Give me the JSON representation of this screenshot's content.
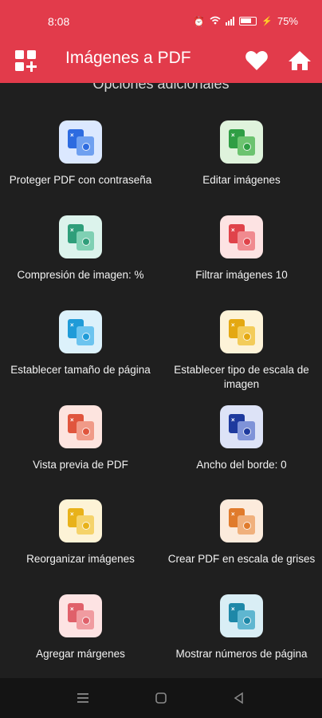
{
  "status": {
    "time": "8:08",
    "battery": "75%"
  },
  "app_bar": {
    "title": "Imágenes a PDF",
    "icons": [
      "apps-add-icon",
      "heart-icon",
      "home-icon"
    ]
  },
  "section_title": "Opciones adicionales",
  "options": [
    {
      "label": "Proteger PDF con contraseña",
      "icon": "lock-shield-icon",
      "tile": "#dbe8ff",
      "back": "#2d6be0",
      "front": "#6fa0f0"
    },
    {
      "label": "Editar imágenes",
      "icon": "edit-image-icon",
      "tile": "#dff3dc",
      "back": "#2f9e44",
      "front": "#6cc36f"
    },
    {
      "label": "Compresión de imagen: %",
      "icon": "compress-icon",
      "tile": "#dcf3ec",
      "back": "#2f9e7a",
      "front": "#7fd0b3"
    },
    {
      "label": "Filtrar imágenes 10",
      "icon": "filter-icon",
      "tile": "#fde3e3",
      "back": "#e0434a",
      "front": "#f08a8f"
    },
    {
      "label": "Establecer tamaño de página",
      "icon": "page-size-icon",
      "tile": "#dcf1fb",
      "back": "#1f9bd8",
      "front": "#6cc4ef"
    },
    {
      "label": "Establecer tipo de escala de imagen",
      "icon": "scale-type-icon",
      "tile": "#fdf3d8",
      "back": "#e4a812",
      "front": "#f3cc5a"
    },
    {
      "label": "Vista previa de PDF",
      "icon": "preview-eye-icon",
      "tile": "#fde4df",
      "back": "#e0553d",
      "front": "#f09a88"
    },
    {
      "label": "Ancho del borde: 0",
      "icon": "border-width-icon",
      "tile": "#dde3f7",
      "back": "#1e3a9e",
      "front": "#7f93d8"
    },
    {
      "label": "Reorganizar imágenes",
      "icon": "rearrange-icon",
      "tile": "#fdf3d6",
      "back": "#e8b21a",
      "front": "#f5d36a"
    },
    {
      "label": "Crear PDF en escala de grises",
      "icon": "grayscale-icon",
      "tile": "#fcebdc",
      "back": "#e07b2c",
      "front": "#f0b07c"
    },
    {
      "label": "Agregar márgenes",
      "icon": "margins-icon",
      "tile": "#fde3e3",
      "back": "#e0606a",
      "front": "#f09ba0"
    },
    {
      "label": "Mostrar números de página",
      "icon": "page-numbers-icon",
      "tile": "#d9eef5",
      "back": "#1e88a8",
      "front": "#5fb6d0"
    }
  ],
  "nav": [
    "recents-icon",
    "home-circle-icon",
    "back-triangle-icon"
  ],
  "colors": {
    "accent": "#e23b4b",
    "background": "#1f1f1f",
    "nav": "#141414"
  }
}
